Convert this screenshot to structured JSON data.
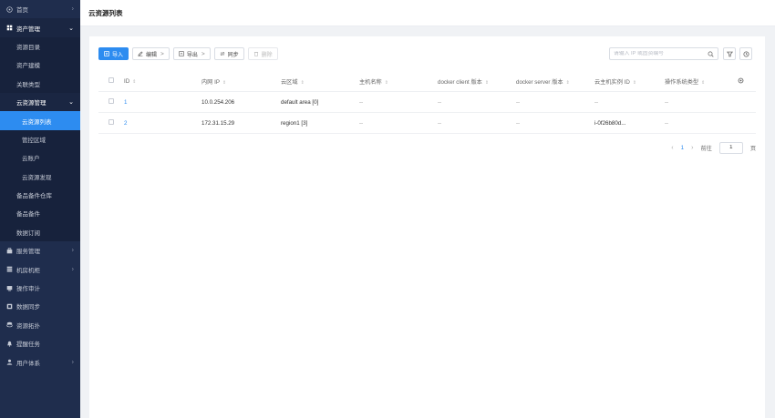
{
  "sidebar": {
    "items": [
      {
        "label": "首页",
        "icon": "home-icon",
        "arrow": "›"
      },
      {
        "label": "资产管理",
        "icon": "asset-icon",
        "arrow": "⌄",
        "children": [
          {
            "label": "资源目录"
          },
          {
            "label": "资产建模"
          },
          {
            "label": "关联类型"
          },
          {
            "label": "云资源管理",
            "arrow": "⌄",
            "children": [
              {
                "label": "云资源列表"
              },
              {
                "label": "管控区域"
              },
              {
                "label": "云账户"
              },
              {
                "label": "云资源发现"
              }
            ]
          },
          {
            "label": "备品备件仓库"
          },
          {
            "label": "备品备件"
          },
          {
            "label": "数据订阅"
          }
        ]
      },
      {
        "label": "服务管理",
        "icon": "service-icon",
        "arrow": "›"
      },
      {
        "label": "机房机柜",
        "icon": "server-icon",
        "arrow": "›"
      },
      {
        "label": "操作审计",
        "icon": "audit-icon"
      },
      {
        "label": "数据同步",
        "icon": "sync-icon"
      },
      {
        "label": "资源拓扑",
        "icon": "topology-icon"
      },
      {
        "label": "提醒任务",
        "icon": "bell-icon"
      },
      {
        "label": "用户体系",
        "icon": "user-icon",
        "arrow": "›"
      }
    ]
  },
  "header": {
    "title": "云资源列表"
  },
  "toolbar": {
    "import": "导入",
    "edit": "编辑",
    "export": "导出",
    "sync": "同步",
    "delete": "删除",
    "chev": ">"
  },
  "search": {
    "placeholder": "请输入 IP 或固资编号"
  },
  "table": {
    "headers": [
      "ID",
      "内网 IP",
      "云区域",
      "主机名称",
      "docker client 版本",
      "docker server 版本",
      "云主机实例 ID",
      "操作系统类型"
    ],
    "sort_glyph": "⇕",
    "rows": [
      {
        "id": "1",
        "ip": "10.0.254.206",
        "region": "default area [0]",
        "host": "--",
        "client": "--",
        "server": "--",
        "instance": "--",
        "os": "--"
      },
      {
        "id": "2",
        "ip": "172.31.15.29",
        "region": "region1 [3]",
        "host": "--",
        "client": "--",
        "server": "--",
        "instance": "i-0f26b80d...",
        "os": "--"
      }
    ]
  },
  "pagination": {
    "prev": "‹",
    "page": "1",
    "next": "›",
    "goto_label": "前往",
    "goto_value": "1",
    "page_unit": "页"
  },
  "colors": {
    "sidebar": "#1f2d4d",
    "accent": "#2d8cf0"
  }
}
